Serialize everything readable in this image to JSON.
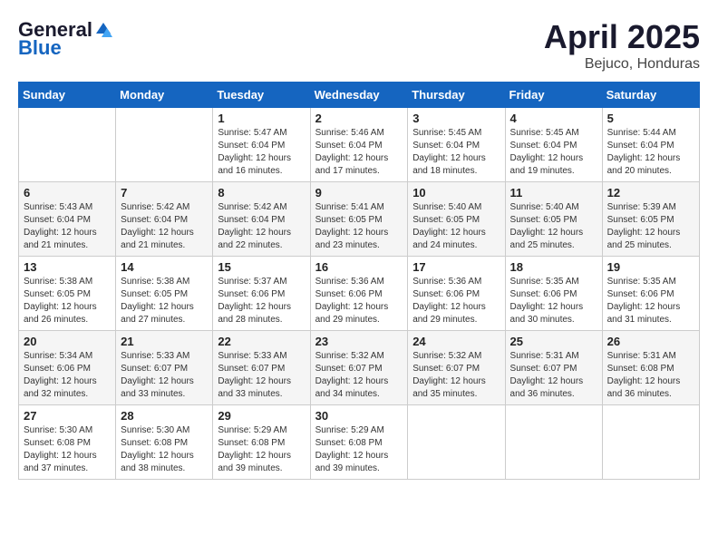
{
  "logo": {
    "general": "General",
    "blue": "Blue"
  },
  "title": {
    "month": "April 2025",
    "location": "Bejuco, Honduras"
  },
  "header_days": [
    "Sunday",
    "Monday",
    "Tuesday",
    "Wednesday",
    "Thursday",
    "Friday",
    "Saturday"
  ],
  "weeks": [
    [
      {
        "day": "",
        "info": ""
      },
      {
        "day": "",
        "info": ""
      },
      {
        "day": "1",
        "info": "Sunrise: 5:47 AM\nSunset: 6:04 PM\nDaylight: 12 hours and 16 minutes."
      },
      {
        "day": "2",
        "info": "Sunrise: 5:46 AM\nSunset: 6:04 PM\nDaylight: 12 hours and 17 minutes."
      },
      {
        "day": "3",
        "info": "Sunrise: 5:45 AM\nSunset: 6:04 PM\nDaylight: 12 hours and 18 minutes."
      },
      {
        "day": "4",
        "info": "Sunrise: 5:45 AM\nSunset: 6:04 PM\nDaylight: 12 hours and 19 minutes."
      },
      {
        "day": "5",
        "info": "Sunrise: 5:44 AM\nSunset: 6:04 PM\nDaylight: 12 hours and 20 minutes."
      }
    ],
    [
      {
        "day": "6",
        "info": "Sunrise: 5:43 AM\nSunset: 6:04 PM\nDaylight: 12 hours and 21 minutes."
      },
      {
        "day": "7",
        "info": "Sunrise: 5:42 AM\nSunset: 6:04 PM\nDaylight: 12 hours and 21 minutes."
      },
      {
        "day": "8",
        "info": "Sunrise: 5:42 AM\nSunset: 6:04 PM\nDaylight: 12 hours and 22 minutes."
      },
      {
        "day": "9",
        "info": "Sunrise: 5:41 AM\nSunset: 6:05 PM\nDaylight: 12 hours and 23 minutes."
      },
      {
        "day": "10",
        "info": "Sunrise: 5:40 AM\nSunset: 6:05 PM\nDaylight: 12 hours and 24 minutes."
      },
      {
        "day": "11",
        "info": "Sunrise: 5:40 AM\nSunset: 6:05 PM\nDaylight: 12 hours and 25 minutes."
      },
      {
        "day": "12",
        "info": "Sunrise: 5:39 AM\nSunset: 6:05 PM\nDaylight: 12 hours and 25 minutes."
      }
    ],
    [
      {
        "day": "13",
        "info": "Sunrise: 5:38 AM\nSunset: 6:05 PM\nDaylight: 12 hours and 26 minutes."
      },
      {
        "day": "14",
        "info": "Sunrise: 5:38 AM\nSunset: 6:05 PM\nDaylight: 12 hours and 27 minutes."
      },
      {
        "day": "15",
        "info": "Sunrise: 5:37 AM\nSunset: 6:06 PM\nDaylight: 12 hours and 28 minutes."
      },
      {
        "day": "16",
        "info": "Sunrise: 5:36 AM\nSunset: 6:06 PM\nDaylight: 12 hours and 29 minutes."
      },
      {
        "day": "17",
        "info": "Sunrise: 5:36 AM\nSunset: 6:06 PM\nDaylight: 12 hours and 29 minutes."
      },
      {
        "day": "18",
        "info": "Sunrise: 5:35 AM\nSunset: 6:06 PM\nDaylight: 12 hours and 30 minutes."
      },
      {
        "day": "19",
        "info": "Sunrise: 5:35 AM\nSunset: 6:06 PM\nDaylight: 12 hours and 31 minutes."
      }
    ],
    [
      {
        "day": "20",
        "info": "Sunrise: 5:34 AM\nSunset: 6:06 PM\nDaylight: 12 hours and 32 minutes."
      },
      {
        "day": "21",
        "info": "Sunrise: 5:33 AM\nSunset: 6:07 PM\nDaylight: 12 hours and 33 minutes."
      },
      {
        "day": "22",
        "info": "Sunrise: 5:33 AM\nSunset: 6:07 PM\nDaylight: 12 hours and 33 minutes."
      },
      {
        "day": "23",
        "info": "Sunrise: 5:32 AM\nSunset: 6:07 PM\nDaylight: 12 hours and 34 minutes."
      },
      {
        "day": "24",
        "info": "Sunrise: 5:32 AM\nSunset: 6:07 PM\nDaylight: 12 hours and 35 minutes."
      },
      {
        "day": "25",
        "info": "Sunrise: 5:31 AM\nSunset: 6:07 PM\nDaylight: 12 hours and 36 minutes."
      },
      {
        "day": "26",
        "info": "Sunrise: 5:31 AM\nSunset: 6:08 PM\nDaylight: 12 hours and 36 minutes."
      }
    ],
    [
      {
        "day": "27",
        "info": "Sunrise: 5:30 AM\nSunset: 6:08 PM\nDaylight: 12 hours and 37 minutes."
      },
      {
        "day": "28",
        "info": "Sunrise: 5:30 AM\nSunset: 6:08 PM\nDaylight: 12 hours and 38 minutes."
      },
      {
        "day": "29",
        "info": "Sunrise: 5:29 AM\nSunset: 6:08 PM\nDaylight: 12 hours and 39 minutes."
      },
      {
        "day": "30",
        "info": "Sunrise: 5:29 AM\nSunset: 6:08 PM\nDaylight: 12 hours and 39 minutes."
      },
      {
        "day": "",
        "info": ""
      },
      {
        "day": "",
        "info": ""
      },
      {
        "day": "",
        "info": ""
      }
    ]
  ]
}
